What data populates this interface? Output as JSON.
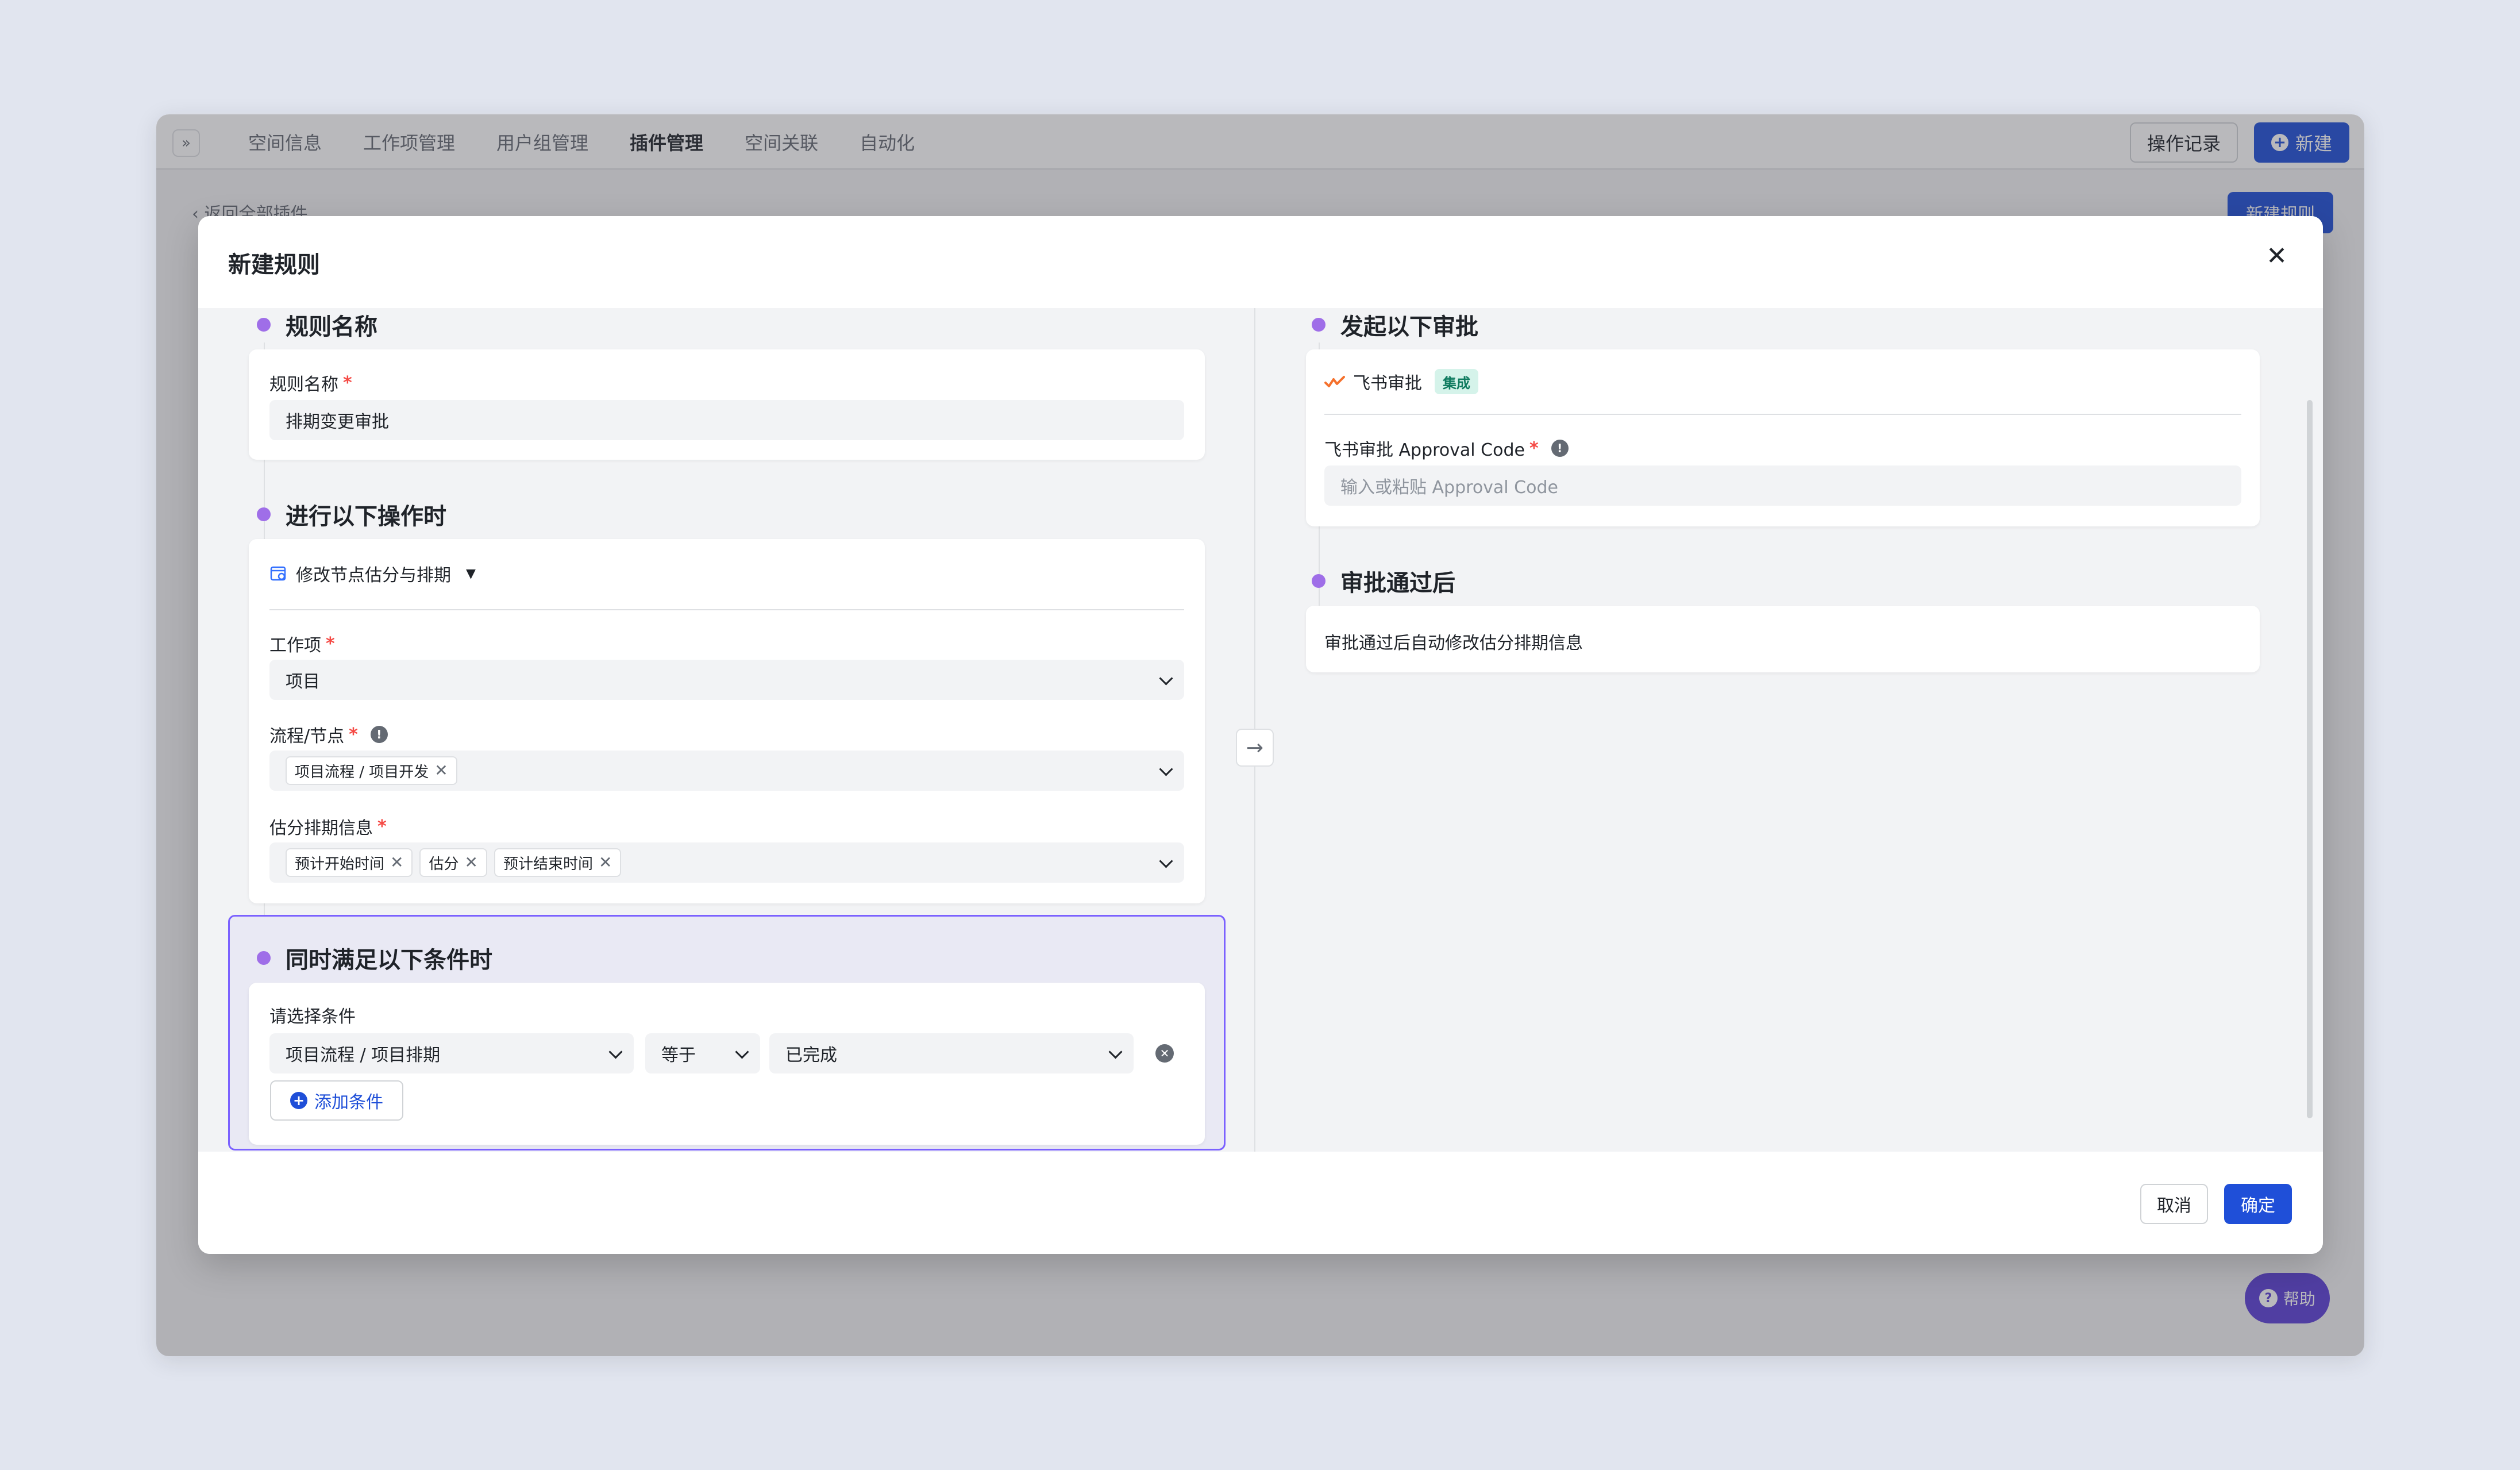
{
  "topbar": {
    "tabs": [
      {
        "label": "空间信息"
      },
      {
        "label": "工作项管理"
      },
      {
        "label": "用户组管理"
      },
      {
        "label": "插件管理"
      },
      {
        "label": "空间关联"
      },
      {
        "label": "自动化"
      }
    ],
    "active_tab": "插件管理",
    "log_button": "操作记录",
    "new_button": "新建"
  },
  "page": {
    "back_link": "返回全部插件",
    "new_rule_button": "新建规则",
    "help_button": "帮助"
  },
  "modal": {
    "title": "新建规则",
    "cancel_label": "取消",
    "confirm_label": "确定",
    "sections": {
      "rule_name": {
        "title": "规则名称",
        "field_label": "规则名称",
        "value": "排期变更审批"
      },
      "trigger": {
        "title": "进行以下操作时",
        "operation": "修改节点估分与排期",
        "work_item_label": "工作项",
        "work_item_value": "项目",
        "flow_label": "流程/节点",
        "flow_tags": [
          "项目流程 / 项目开发"
        ],
        "estimate_label": "估分排期信息",
        "estimate_tags": [
          "预计开始时间",
          "估分",
          "预计结束时间"
        ]
      },
      "conditions": {
        "title": "同时满足以下条件时",
        "label": "请选择条件",
        "field": "项目流程 / 项目排期",
        "operator": "等于",
        "value": "已完成",
        "add_label": "添加条件"
      },
      "approval": {
        "title": "发起以下审批",
        "provider": "飞书审批",
        "badge": "集成",
        "code_label": "飞书审批 Approval Code",
        "code_placeholder": "输入或粘贴 Approval Code"
      },
      "after": {
        "title": "审批通过后",
        "description": "审批通过后自动修改估分排期信息"
      }
    }
  }
}
